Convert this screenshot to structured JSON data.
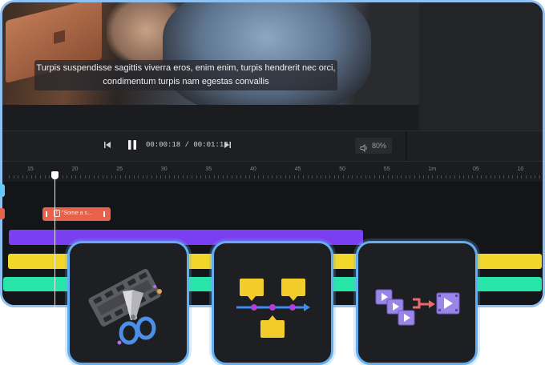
{
  "video": {
    "subtitle_line1": "Turpis suspendisse sagittis viverra eros, enim enim, turpis hendrerit nec orci,",
    "subtitle_line2": "condimentum turpis nam egestas convallis"
  },
  "player": {
    "time": "00:00:18 / 00:01:13",
    "volume": "80%",
    "prev_icon": "skip-previous-icon",
    "pause_icon": "pause-icon",
    "next_icon": "skip-next-icon",
    "volume_icon": "speaker-icon"
  },
  "ruler": {
    "labels": [
      "15",
      "20",
      "25",
      "30",
      "35",
      "40",
      "45",
      "50",
      "55",
      "1m",
      "05",
      "10"
    ]
  },
  "timeline": {
    "text_clip_label": "\"Some a s...",
    "colors": {
      "text_clip": "#e8614a",
      "purple_track": "#7b3ff2",
      "yellow_track": "#f2d72b",
      "green_track": "#28e6a7",
      "card_border": "#64aef0"
    }
  },
  "feature_cards": [
    {
      "icon": "film-scissors-icon"
    },
    {
      "icon": "timeline-markers-icon"
    },
    {
      "icon": "merge-clips-icon"
    }
  ]
}
